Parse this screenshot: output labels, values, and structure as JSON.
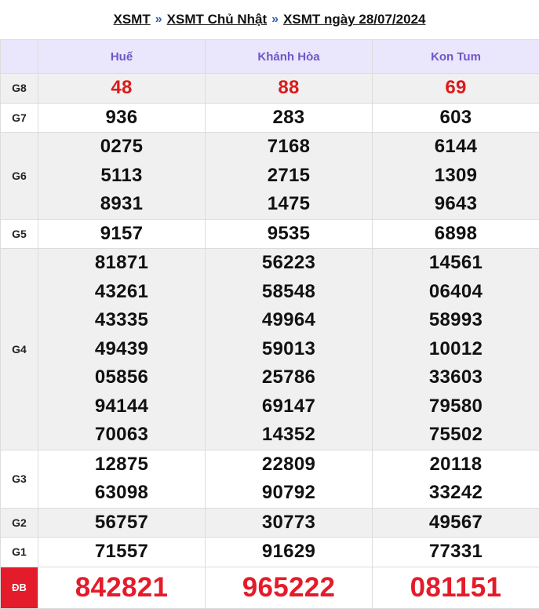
{
  "breadcrumb": {
    "items": [
      "XSMT",
      "XSMT Chủ Nhật",
      "XSMT ngày 28/07/2024"
    ],
    "separator": "»"
  },
  "provinces": [
    "Huế",
    "Khánh Hòa",
    "Kon Tum"
  ],
  "prizes": [
    {
      "label": "G8",
      "style": "alt",
      "red": true,
      "values": [
        [
          "48"
        ],
        [
          "88"
        ],
        [
          "69"
        ]
      ]
    },
    {
      "label": "G7",
      "style": "plain",
      "values": [
        [
          "936"
        ],
        [
          "283"
        ],
        [
          "603"
        ]
      ]
    },
    {
      "label": "G6",
      "style": "alt",
      "values": [
        [
          "0275",
          "5113",
          "8931"
        ],
        [
          "7168",
          "2715",
          "1475"
        ],
        [
          "6144",
          "1309",
          "9643"
        ]
      ]
    },
    {
      "label": "G5",
      "style": "plain",
      "values": [
        [
          "9157"
        ],
        [
          "9535"
        ],
        [
          "6898"
        ]
      ]
    },
    {
      "label": "G4",
      "style": "alt",
      "values": [
        [
          "81871",
          "43261",
          "43335",
          "49439",
          "05856",
          "94144",
          "70063"
        ],
        [
          "56223",
          "58548",
          "49964",
          "59013",
          "25786",
          "69147",
          "14352"
        ],
        [
          "14561",
          "06404",
          "58993",
          "10012",
          "33603",
          "79580",
          "75502"
        ]
      ]
    },
    {
      "label": "G3",
      "style": "plain",
      "values": [
        [
          "12875",
          "63098"
        ],
        [
          "22809",
          "90792"
        ],
        [
          "20118",
          "33242"
        ]
      ]
    },
    {
      "label": "G2",
      "style": "alt",
      "values": [
        [
          "56757"
        ],
        [
          "30773"
        ],
        [
          "49567"
        ]
      ]
    },
    {
      "label": "G1",
      "style": "plain",
      "values": [
        [
          "71557"
        ],
        [
          "91629"
        ],
        [
          "77331"
        ]
      ]
    }
  ],
  "special": {
    "label": "ĐB",
    "values": [
      "842821",
      "965222",
      "081151"
    ]
  },
  "colors": {
    "header_bg": "#eae6fb",
    "header_text": "#6f56c8",
    "red": "#e01818",
    "db_bg": "#e41b2a",
    "alt_row": "#f0f0f0"
  }
}
